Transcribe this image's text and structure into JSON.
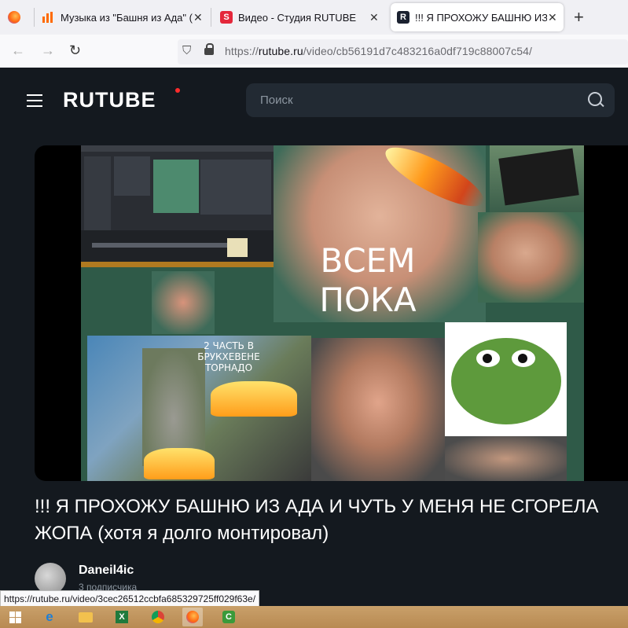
{
  "browser": {
    "tabs": [
      {
        "label": "",
        "icon": "firefox-icon"
      },
      {
        "label": "Музыка из \"Башня из Ада\" (То",
        "icon": "bars-icon"
      },
      {
        "label": "Видео - Студия RUTUBE",
        "icon": "studio-icon"
      },
      {
        "label": "!!! Я ПРОХОЖУ БАШНЮ ИЗ А",
        "icon": "rutube-icon"
      }
    ],
    "new_tab": "+",
    "url_prefix": "https://",
    "url_host": "rutube.ru",
    "url_path": "/video/cb56191d7c483216a0df719c88007c54/"
  },
  "site": {
    "logo": "RUTUBE",
    "search_placeholder": "Поиск",
    "accent": "#ff2c2c"
  },
  "video": {
    "overlay_main_1": "ВСЕМ",
    "overlay_main_2": "ПОКА",
    "overlay_small_1": "2 ЧАСТЬ В",
    "overlay_small_2": "БРУКХЕВЕНЕ",
    "overlay_small_3": "ТОРНАДО",
    "title": "!!! Я ПРОХОЖУ БАШНЮ ИЗ АДА И ЧУТЬ У МЕНЯ НЕ СГОРЕЛА ЖОПА (хотя я долго монтировал)",
    "author": "Daneil4ic",
    "subscribers": "3 подписчика"
  },
  "status_url": "https://rutube.ru/video/3cec26512ccbfa685329725ff029f63e/",
  "taskbar": [
    "windows-start-icon",
    "ie-icon",
    "explorer-icon",
    "excel-icon",
    "chrome-icon",
    "firefox-icon",
    "camtasia-icon"
  ]
}
